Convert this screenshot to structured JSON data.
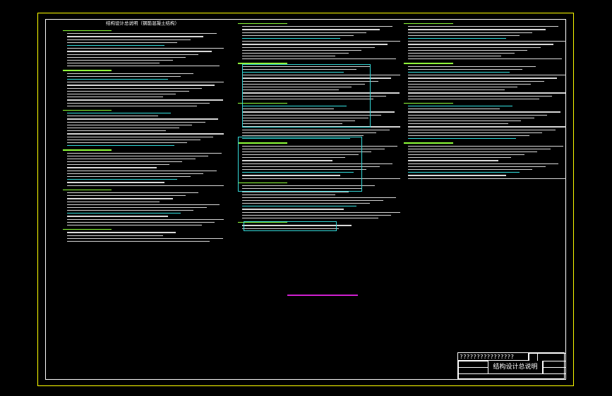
{
  "document": {
    "header": "结构设计总说明（钢筋混凝土结构）",
    "title_block": {
      "project": "????????????????",
      "drawing_title": "结构设计总说明"
    }
  },
  "colors": {
    "frame": "#ffff00",
    "table": "#33d6d6",
    "heading": "#8fff3a",
    "highlight": "#d020d0"
  }
}
